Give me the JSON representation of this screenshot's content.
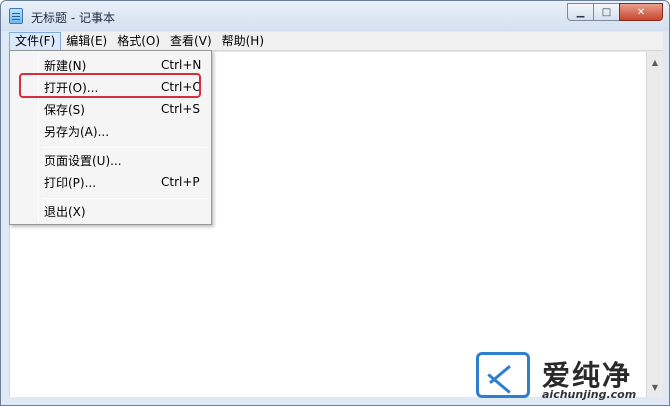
{
  "window": {
    "title": "无标题 - 记事本",
    "minimize_glyph": "▁",
    "maximize_glyph": "□",
    "close_glyph": "✕"
  },
  "menubar": {
    "items": [
      {
        "label": "文件(F)"
      },
      {
        "label": "编辑(E)"
      },
      {
        "label": "格式(O)"
      },
      {
        "label": "查看(V)"
      },
      {
        "label": "帮助(H)"
      }
    ]
  },
  "file_menu": {
    "items": [
      {
        "label": "新建(N)",
        "shortcut": "Ctrl+N"
      },
      {
        "label": "打开(O)...",
        "shortcut": "Ctrl+O"
      },
      {
        "label": "保存(S)",
        "shortcut": "Ctrl+S"
      },
      {
        "label": "另存为(A)...",
        "shortcut": ""
      },
      {
        "label": "页面设置(U)...",
        "shortcut": ""
      },
      {
        "label": "打印(P)...",
        "shortcut": "Ctrl+P"
      },
      {
        "label": "退出(X)",
        "shortcut": ""
      }
    ],
    "highlighted_item": "打开(O)...",
    "highlight_color": "#d4303c"
  },
  "scrollbar": {
    "up_glyph": "▲",
    "down_glyph": "▼"
  },
  "watermark": {
    "text_cn": "爱纯净",
    "url": "aichunjing.com",
    "brand_color": "#2f7fd1"
  }
}
